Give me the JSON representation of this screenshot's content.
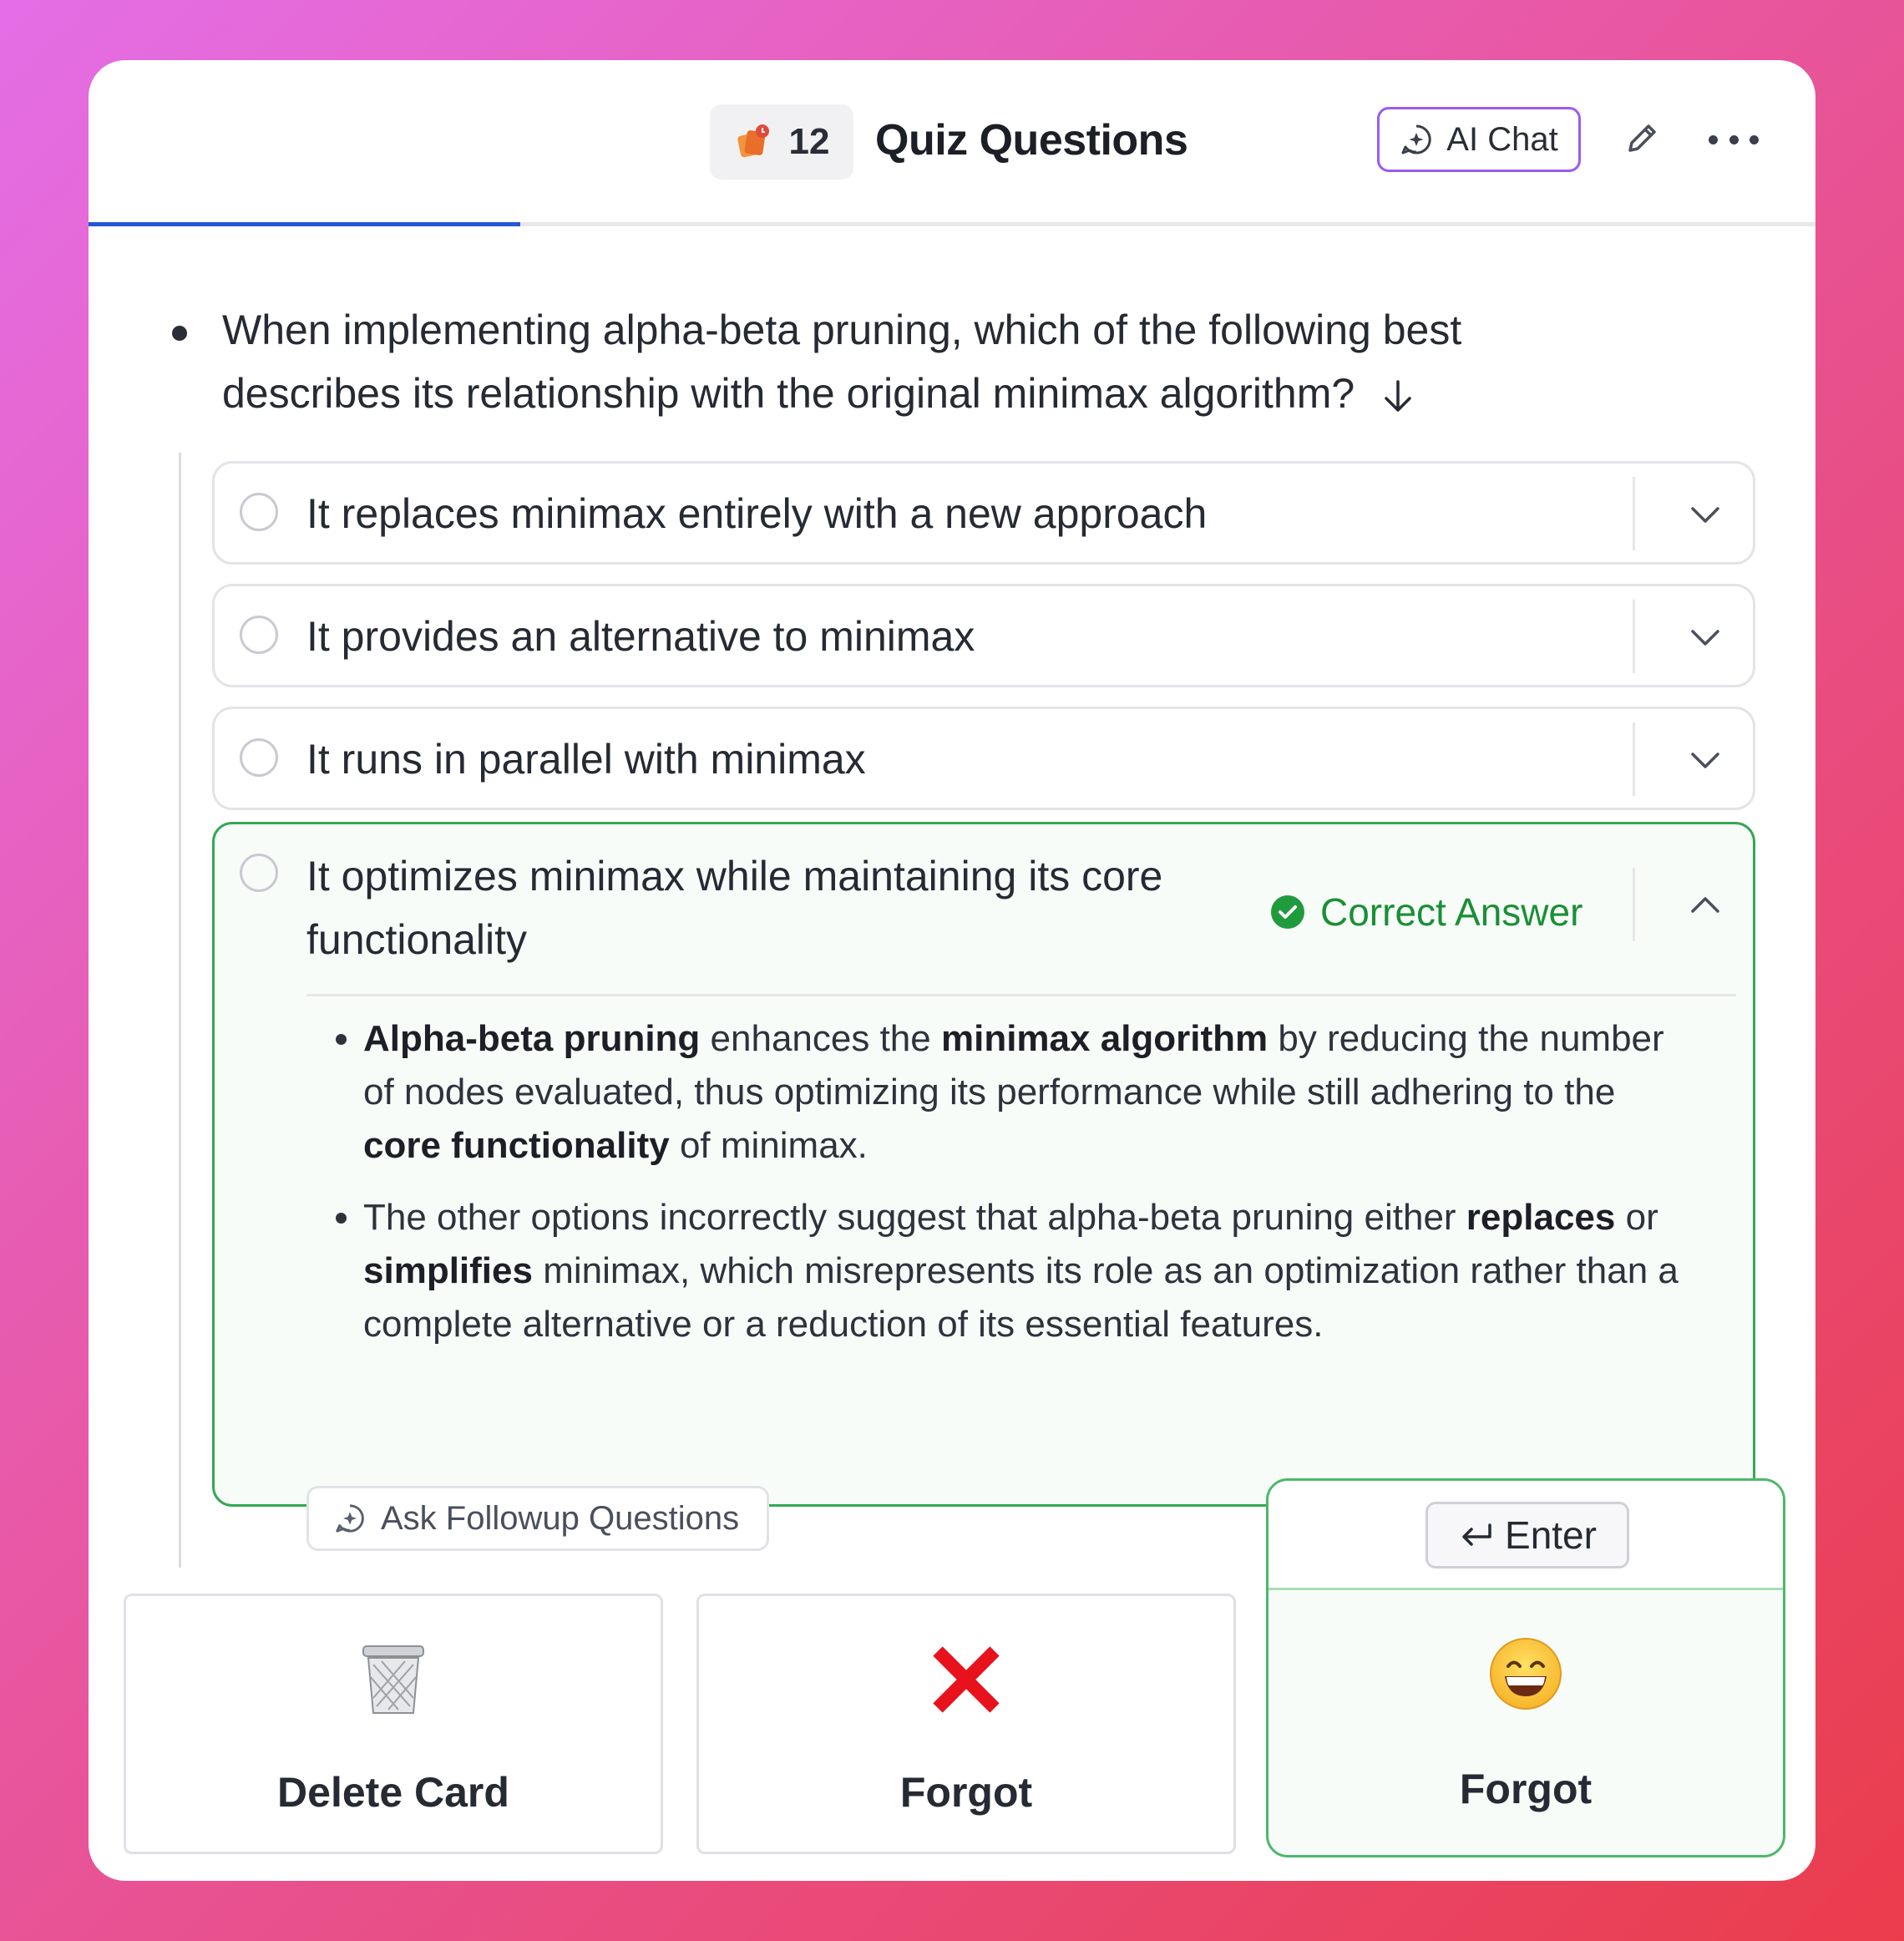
{
  "header": {
    "badge_count": "12",
    "title": "Quiz Questions",
    "ai_chat_label": "AI Chat",
    "progress_fraction": 0.25
  },
  "question": {
    "text": "When implementing alpha-beta pruning, which of the following best describes its relationship with the original minimax algorithm?"
  },
  "options": [
    {
      "label": "It replaces minimax entirely with a new approach"
    },
    {
      "label": "It provides an alternative to minimax"
    },
    {
      "label": "It runs in parallel with minimax"
    },
    {
      "label": "It optimizes minimax while maintaining its core functionality",
      "status": "Correct Answer"
    }
  ],
  "explanation": {
    "p1_b1": "Alpha-beta pruning",
    "p1_t1": " enhances the ",
    "p1_b2": "minimax algorithm",
    "p1_t2": " by reducing the number of nodes evaluated, thus optimizing its performance while still adhering to the ",
    "p1_b3": "core functionality",
    "p1_t3": " of minimax.",
    "p2_t1": "The other options incorrectly suggest that alpha-beta pruning either ",
    "p2_b1": "replaces",
    "p2_t2": " or ",
    "p2_b2": "simplifies",
    "p2_t3": " minimax, which misrepresents its role as an optimization rather than a complete alternative or a reduction of its essential features."
  },
  "followup_label": "Ask Followup Questions",
  "actions": {
    "delete_label": "Delete Card",
    "forgot_label": "Forgot",
    "primary_label": "Forgot",
    "enter_key_label": "Enter",
    "delete_icon": "🗑️",
    "forgot_icon": "❌",
    "primary_icon": "😄"
  },
  "colors": {
    "accent_purple": "#9a5cf0",
    "progress_blue": "#2557d6",
    "correct_green": "#1a8f35"
  }
}
